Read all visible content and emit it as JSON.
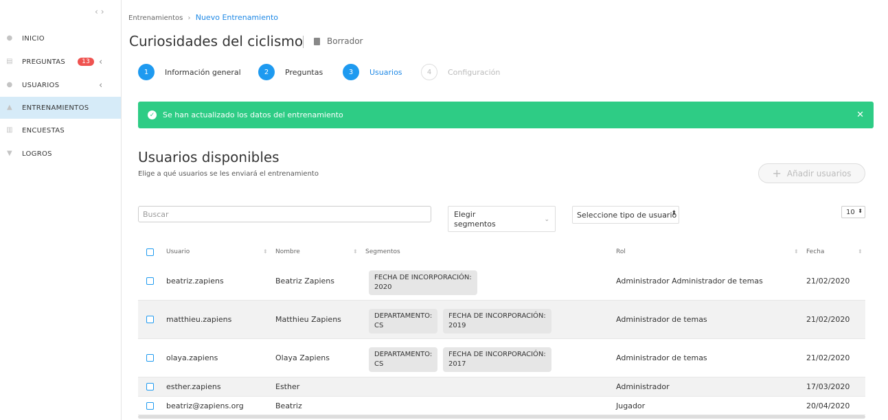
{
  "sidebar": {
    "items": [
      {
        "label": "INICIO"
      },
      {
        "label": "PREGUNTAS",
        "badge": "13"
      },
      {
        "label": "USUARIOS"
      },
      {
        "label": "ENTRENAMIENTOS"
      },
      {
        "label": "ENCUESTAS"
      },
      {
        "label": "LOGROS"
      }
    ]
  },
  "breadcrumb": {
    "parent": "Entrenamientos",
    "current": "Nuevo Entrenamiento"
  },
  "page": {
    "title": "Curiosidades del ciclismo",
    "status": "Borrador"
  },
  "steps": [
    {
      "num": "1",
      "label": "Información general",
      "state": "done"
    },
    {
      "num": "2",
      "label": "Preguntas",
      "state": "done"
    },
    {
      "num": "3",
      "label": "Usuarios",
      "state": "current"
    },
    {
      "num": "4",
      "label": "Configuración",
      "state": "pending"
    }
  ],
  "alert": {
    "message": "Se han actualizado los datos del entrenamiento",
    "color": "#2ecc85"
  },
  "section": {
    "title": "Usuarios disponibles",
    "subtitle": "Elige a qué usuarios se les enviará el entrenamiento",
    "add_button": "Añadir usuarios"
  },
  "filters": {
    "search_placeholder": "Buscar",
    "segments_label_1": "Elegir",
    "segments_label_2": "segmentos",
    "user_type": "Seleccione tipo de usuario",
    "page_size": "10"
  },
  "table": {
    "headers": {
      "user": "Usuario",
      "name": "Nombre",
      "segments": "Segmentos",
      "role": "Rol",
      "date": "Fecha"
    },
    "rows": [
      {
        "user": "beatriz.zapiens",
        "name": "Beatriz Zapiens",
        "tags": [
          {
            "k": "FECHA DE INCORPORACIÓN:",
            "v": "2020"
          }
        ],
        "role": "Administrador Administrador de temas",
        "date": "21/02/2020"
      },
      {
        "user": "matthieu.zapiens",
        "name": "Matthieu Zapiens",
        "tags": [
          {
            "k": "DEPARTAMENTO:",
            "v": "CS"
          },
          {
            "k": "FECHA DE INCORPORACIÓN:",
            "v": "2019"
          }
        ],
        "role": "Administrador de temas",
        "date": "21/02/2020"
      },
      {
        "user": "olaya.zapiens",
        "name": "Olaya Zapiens",
        "tags": [
          {
            "k": "DEPARTAMENTO:",
            "v": "CS"
          },
          {
            "k": "FECHA DE INCORPORACIÓN:",
            "v": "2017"
          }
        ],
        "role": "Administrador de temas",
        "date": "21/02/2020"
      },
      {
        "user": "esther.zapiens",
        "name": "Esther",
        "tags": [],
        "role": "Administrador",
        "date": "17/03/2020"
      },
      {
        "user": "beatriz@zapiens.org",
        "name": "Beatriz",
        "tags": [],
        "role": "Jugador",
        "date": "20/04/2020"
      }
    ]
  }
}
